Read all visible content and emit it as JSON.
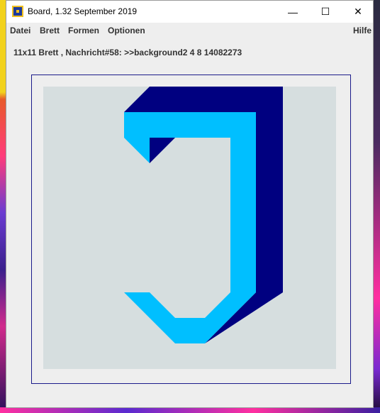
{
  "window": {
    "title": "Board, 1.32   September 2019",
    "controls": {
      "minimize": "—",
      "maximize": "☐",
      "close": "✕"
    }
  },
  "menu": {
    "items": [
      "Datei",
      "Brett",
      "Formen",
      "Optionen"
    ],
    "help": "Hilfe"
  },
  "status_line": "11x11 Brett , Nachricht#58: >>background2 4 8 14082273",
  "board": {
    "size": "11x11",
    "colors": {
      "background": "#d6dedf",
      "light_blue": "#00bfff",
      "navy": "#000080",
      "frame": "#1a1a8a"
    }
  }
}
